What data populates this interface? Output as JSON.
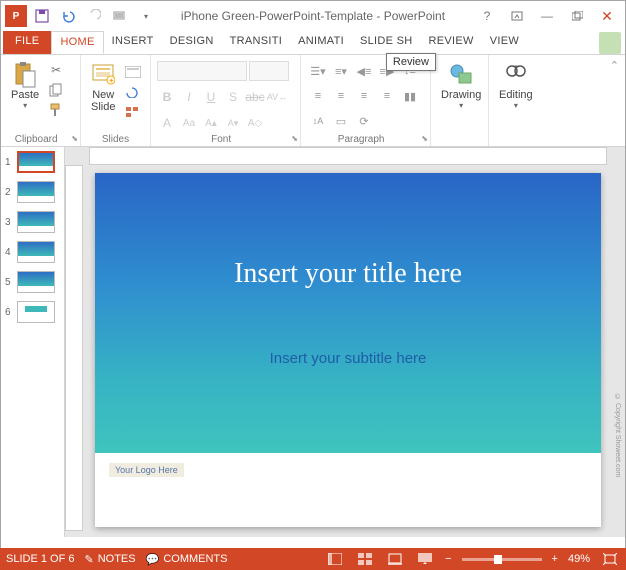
{
  "titlebar": {
    "doc_title": "iPhone Green-PowerPoint-Template - PowerPoint"
  },
  "tabs": {
    "file": "FILE",
    "home": "HOME",
    "insert": "INSERT",
    "design": "DESIGN",
    "transitions": "TRANSITI",
    "animations": "ANIMATI",
    "slideshow": "SLIDE SH",
    "review": "REVIEW",
    "view": "VIEW"
  },
  "ribbon": {
    "clipboard": {
      "label": "Clipboard",
      "paste": "Paste"
    },
    "slides": {
      "label": "Slides",
      "new_slide": "New\nSlide"
    },
    "font": {
      "label": "Font"
    },
    "paragraph": {
      "label": "Paragraph"
    },
    "drawing": {
      "label": "Drawing"
    },
    "editing": {
      "label": "Editing"
    }
  },
  "tooltip": "Review",
  "slide": {
    "title_placeholder": "Insert your title here",
    "subtitle_placeholder": "Insert your subtitle here",
    "logo_placeholder": "Your Logo Here"
  },
  "copyright": "© Copyright Showeet.com",
  "status": {
    "slide_of": "SLIDE 1 OF 6",
    "notes": "NOTES",
    "comments": "COMMENTS",
    "zoom": "49%"
  },
  "thumb_count": 6
}
